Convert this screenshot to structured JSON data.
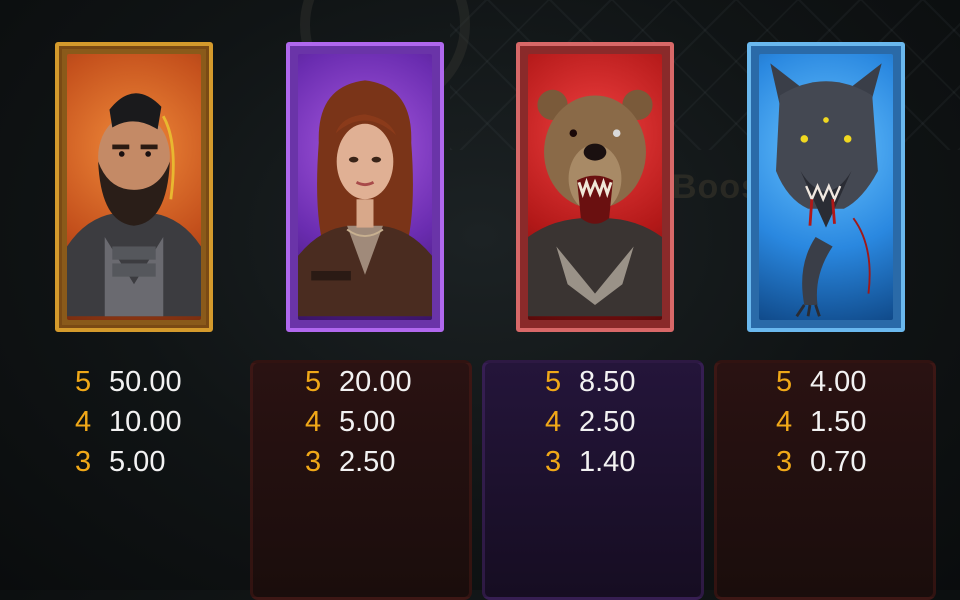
{
  "symbols": [
    {
      "name": "bearded-man",
      "frame_color": "#d49a2c",
      "pays": [
        {
          "count": "5",
          "value": "50.00"
        },
        {
          "count": "4",
          "value": "10.00"
        },
        {
          "count": "3",
          "value": "5.00"
        }
      ]
    },
    {
      "name": "woman",
      "frame_color": "#b068ee",
      "pays": [
        {
          "count": "5",
          "value": "20.00"
        },
        {
          "count": "4",
          "value": "5.00"
        },
        {
          "count": "3",
          "value": "2.50"
        }
      ]
    },
    {
      "name": "bear",
      "frame_color": "#d86868",
      "pays": [
        {
          "count": "5",
          "value": "8.50"
        },
        {
          "count": "4",
          "value": "2.50"
        },
        {
          "count": "3",
          "value": "1.40"
        }
      ]
    },
    {
      "name": "wolf",
      "frame_color": "#6ab8ee",
      "pays": [
        {
          "count": "5",
          "value": "4.00"
        },
        {
          "count": "4",
          "value": "1.50"
        },
        {
          "count": "3",
          "value": "0.70"
        }
      ]
    }
  ],
  "background": {
    "partial_text": "Boost ased"
  },
  "colors": {
    "count": "#f0a818",
    "value": "#f2f2f2"
  }
}
